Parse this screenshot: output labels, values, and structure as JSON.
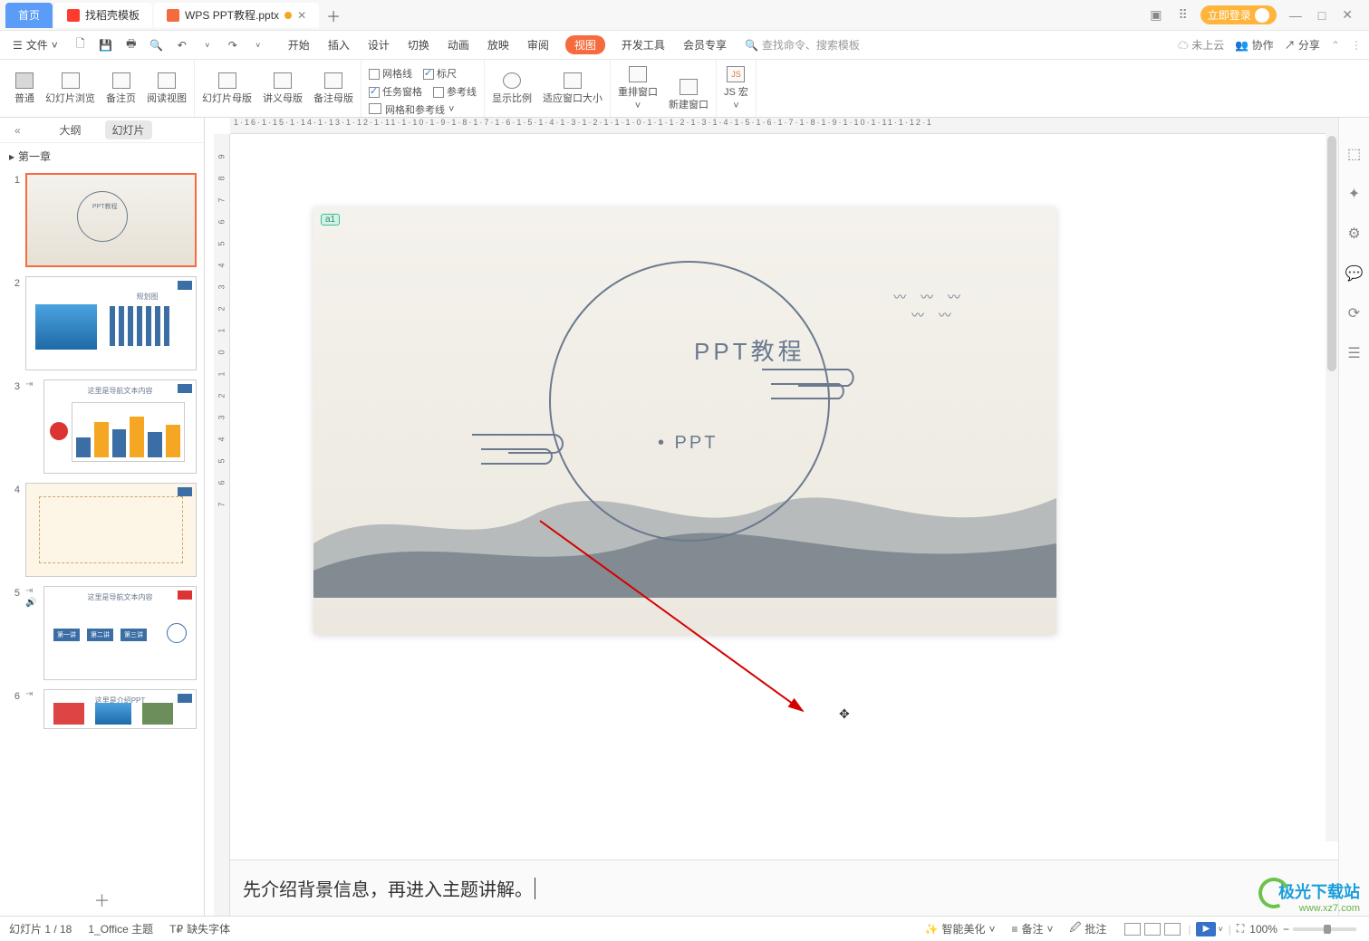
{
  "tabs": {
    "home": "首页",
    "app1": "找稻壳模板",
    "app2": "WPS PPT教程.pptx"
  },
  "titlebar": {
    "login": "立即登录"
  },
  "menubar": {
    "file": "文件",
    "menus": [
      "开始",
      "插入",
      "设计",
      "切换",
      "动画",
      "放映",
      "审阅",
      "视图",
      "开发工具",
      "会员专享"
    ],
    "active_menu": "视图",
    "search_placeholder": "查找命令、搜索模板",
    "cloud": "未上云",
    "collab": "协作",
    "share": "分享"
  },
  "ribbon": {
    "g1": {
      "normal": "普通",
      "browse": "幻灯片浏览",
      "notes": "备注页",
      "reading": "阅读视图"
    },
    "g2": {
      "master": "幻灯片母版",
      "lecture": "讲义母版",
      "notes_master": "备注母版"
    },
    "g3": {
      "gridline": "网格线",
      "ruler": "标尺",
      "taskpane": "任务窗格",
      "guides": "参考线",
      "grid_ref": "网格和参考线"
    },
    "g4": {
      "ratio": "显示比例",
      "fit": "适应窗口大小"
    },
    "g5": {
      "rearrange": "重排窗口",
      "newwin": "新建窗口"
    },
    "g6": {
      "jsmacro": "JS 宏"
    }
  },
  "sidepanel": {
    "outline": "大纲",
    "slides": "幻灯片",
    "section": "第一章",
    "slide2_label": "规划图",
    "slide3_title": "这里是导航文本内容",
    "slide5_title": "这里是导航文本内容",
    "slide5_items": [
      "第一讲",
      "第二讲",
      "第三讲"
    ],
    "slide6_title": "这里是介绍PPT"
  },
  "slide": {
    "tag": "a1",
    "title": "PPT教程",
    "subtitle": "• PPT"
  },
  "notes_text": "先介绍背景信息，再进入主题讲解。",
  "status": {
    "slide_pos": "幻灯片 1 / 18",
    "theme": "1_Office 主题",
    "missing_font": "缺失字体",
    "beautify": "智能美化",
    "notes_btn": "备注",
    "comments": "批注",
    "zoom": "100%"
  },
  "watermark": {
    "name": "极光下载站",
    "url": "www.xz7.com"
  },
  "ruler_h_text": "1·16·1·15·1·14·1·13·1·12·1·11·1·10·1·9·1·8·1·7·1·6·1·5·1·4·1·3·1·2·1·1·1·0·1·1·1·2·1·3·1·4·1·5·1·6·1·7·1·8·1·9·1·10·1·11·1·12·1"
}
